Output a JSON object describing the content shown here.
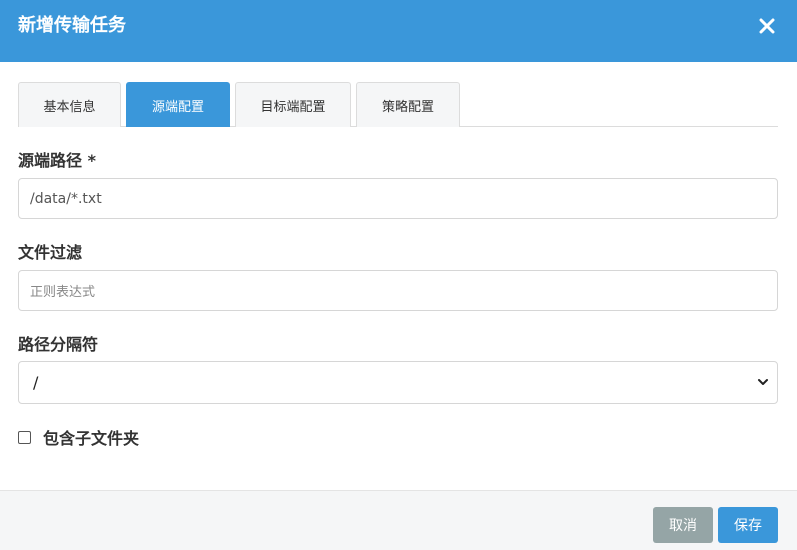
{
  "dialog": {
    "title": "新增传输任务",
    "close_icon": "close-icon"
  },
  "tabs": [
    {
      "label": "基本信息",
      "active": false
    },
    {
      "label": "源端配置",
      "active": true
    },
    {
      "label": "目标端配置",
      "active": false
    },
    {
      "label": "策略配置",
      "active": false
    }
  ],
  "form": {
    "source_path": {
      "label": "源端路径 *",
      "value": "/data/*.txt"
    },
    "file_filter": {
      "label": "文件过滤",
      "placeholder": "正则表达式",
      "value": ""
    },
    "path_separator": {
      "label": "路径分隔符",
      "selected": "/"
    },
    "include_subfolders": {
      "label": "包含子文件夹",
      "checked": false
    }
  },
  "footer": {
    "cancel_label": "取消",
    "save_label": "保存"
  },
  "colors": {
    "primary": "#3a97da",
    "cancel": "#95a5a6"
  }
}
